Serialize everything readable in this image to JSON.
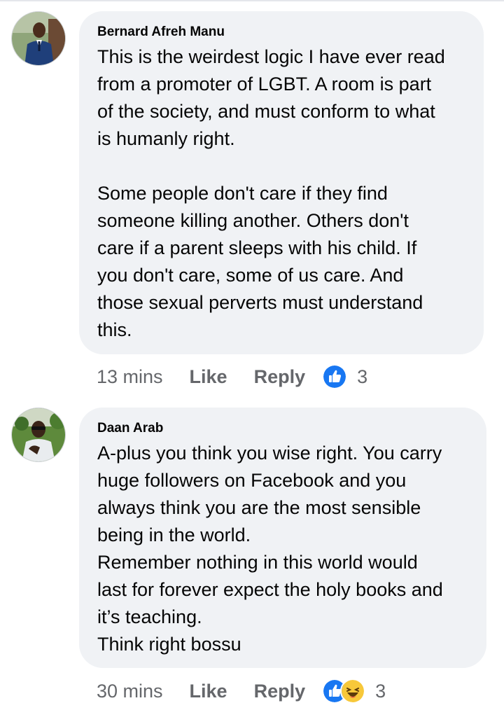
{
  "comments": [
    {
      "author": "Bernard Afreh Manu",
      "paragraphs": [
        [
          "This is the weirdest logic I have ever read",
          "from a promoter of LGBT. A room is part",
          "of the society, and must conform to what",
          "is humanly right."
        ],
        [
          "Some people don't care if they find",
          "someone killing another. Others don't",
          "care if a parent sleeps with his child. If",
          "you don't care, some of us care. And",
          "those sexual perverts must understand",
          "this."
        ]
      ],
      "time": "13 mins",
      "like_label": "Like",
      "reply_label": "Reply",
      "reactions": [
        "like-icon"
      ],
      "reaction_count": "3"
    },
    {
      "author": "Daan Arab",
      "paragraphs": [
        [
          "A-plus you think you wise right. You carry",
          "huge followers on Facebook and you",
          "always think you are the most sensible",
          "being in the world.",
          "Remember nothing in this world would",
          "last for forever expect the holy books and",
          "it’s teaching.",
          "Think right bossu"
        ]
      ],
      "time": "30 mins",
      "like_label": "Like",
      "reply_label": "Reply",
      "reactions": [
        "like-icon",
        "haha-icon"
      ],
      "reaction_count": "3"
    }
  ],
  "colors": {
    "bubble": "#f0f2f5",
    "meta_text": "#65676b",
    "like_blue": "#1877f2",
    "haha_yellow": "#f7c83a"
  }
}
